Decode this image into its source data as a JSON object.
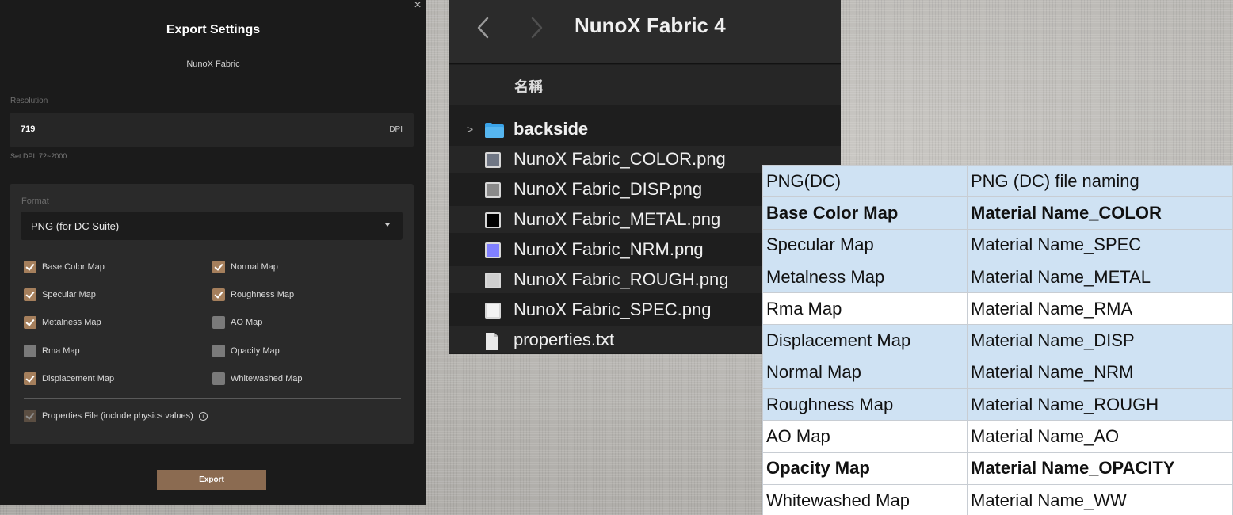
{
  "dialog": {
    "title": "Export Settings",
    "subtitle": "NunoX Fabric",
    "resolution_label": "Resolution",
    "resolution_value": "719",
    "resolution_unit": "DPI",
    "resolution_hint": "Set DPI: 72~2000",
    "format_label": "Format",
    "format_value": "PNG (for DC Suite)",
    "checkboxes": [
      {
        "label": "Base Color Map",
        "checked": true
      },
      {
        "label": "Normal Map",
        "checked": true
      },
      {
        "label": "Specular Map",
        "checked": true
      },
      {
        "label": "Roughness Map",
        "checked": true
      },
      {
        "label": "Metalness Map",
        "checked": true
      },
      {
        "label": "AO Map",
        "checked": false
      },
      {
        "label": "Rma Map",
        "checked": false
      },
      {
        "label": "Opacity Map",
        "checked": false
      },
      {
        "label": "Displacement Map",
        "checked": true
      },
      {
        "label": "Whitewashed Map",
        "checked": false
      }
    ],
    "properties_label": "Properties File (include physics values)",
    "info_glyph": "i",
    "export_label": "Export",
    "close_glyph": "×"
  },
  "finder": {
    "title": "NunoX Fabric 4",
    "column_header": "名稱",
    "rows": [
      {
        "name": "backside",
        "kind": "folder"
      },
      {
        "name": "NunoX Fabric_COLOR.png",
        "kind": "image",
        "swatch": "#6f7684"
      },
      {
        "name": "NunoX Fabric_DISP.png",
        "kind": "image",
        "swatch": "#8a8a8a"
      },
      {
        "name": "NunoX Fabric_METAL.png",
        "kind": "image",
        "swatch": "#000000"
      },
      {
        "name": "NunoX Fabric_NRM.png",
        "kind": "image",
        "swatch": "#8080ff"
      },
      {
        "name": "NunoX Fabric_ROUGH.png",
        "kind": "image",
        "swatch": "#cfcfcf"
      },
      {
        "name": "NunoX Fabric_SPEC.png",
        "kind": "image",
        "swatch": "#f2f2f2"
      },
      {
        "name": "properties.txt",
        "kind": "document"
      }
    ]
  },
  "naming_table": {
    "rows": [
      {
        "map": "PNG(DC)",
        "name": "PNG (DC) file naming",
        "style": "blue",
        "bold": false
      },
      {
        "map": "Base Color Map",
        "name": "Material Name_COLOR",
        "style": "blue",
        "bold": true
      },
      {
        "map": "Specular Map",
        "name": "Material Name_SPEC",
        "style": "blue",
        "bold": false
      },
      {
        "map": "Metalness Map",
        "name": "Material Name_METAL",
        "style": "blue",
        "bold": false
      },
      {
        "map": "Rma Map",
        "name": "Material Name_RMA",
        "style": "white",
        "bold": false
      },
      {
        "map": "Displacement Map",
        "name": "Material Name_DISP",
        "style": "blue",
        "bold": false
      },
      {
        "map": "Normal Map",
        "name": "Material Name_NRM",
        "style": "blue",
        "bold": false
      },
      {
        "map": "Roughness Map",
        "name": "Material Name_ROUGH",
        "style": "blue",
        "bold": false
      },
      {
        "map": "AO Map",
        "name": "Material Name_AO",
        "style": "white",
        "bold": false
      },
      {
        "map": "Opacity Map",
        "name": "Material Name_OPACITY",
        "style": "white",
        "bold": true
      },
      {
        "map": "Whitewashed Map",
        "name": "Material Name_WW",
        "style": "white",
        "bold": false
      }
    ]
  },
  "colors": {
    "accent": "#a57f5c",
    "export_button": "#8b6b51",
    "folder_blue": "#3aa3e8",
    "table_blue": "#cfe2f3"
  }
}
